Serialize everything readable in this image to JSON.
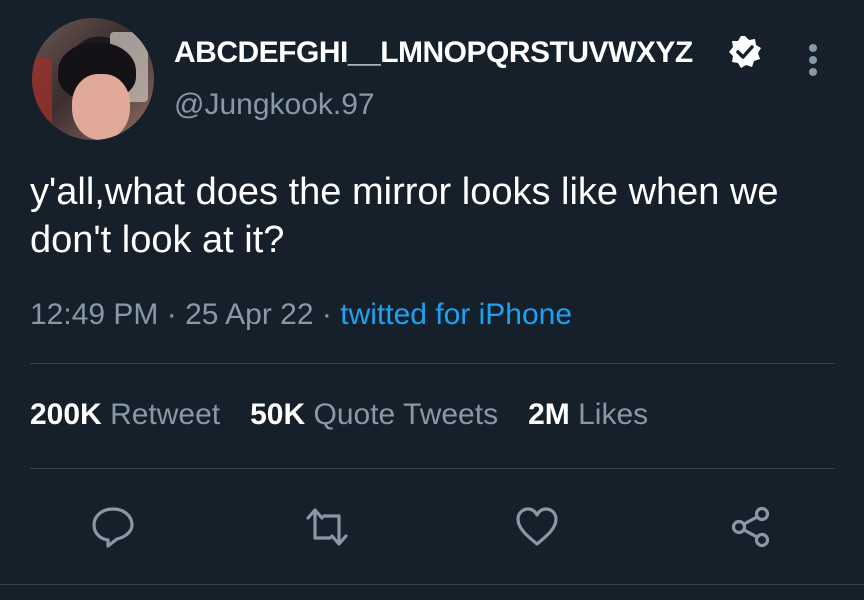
{
  "author": {
    "display_name": "ABCDEFGHI__LMNOPQRSTUVWXYZ",
    "handle": "@Jungkook.97",
    "verified": true
  },
  "tweet": {
    "text": "y'all,what does the mirror looks like when we don't look at it?",
    "time": "12:49 PM",
    "separator": "·",
    "date": "25 Apr 22",
    "source": "twitted for iPhone"
  },
  "stats": {
    "retweets_count": "200K",
    "retweets_label": "Retweet",
    "quotes_count": "50K",
    "quotes_label": "Quote Tweets",
    "likes_count": "2M",
    "likes_label": "Likes"
  },
  "icons": {
    "more": "more-vertical-icon",
    "verified": "verified-badge-icon",
    "reply": "reply-icon",
    "retweet": "retweet-icon",
    "like": "heart-icon",
    "share": "share-icon"
  },
  "colors": {
    "background": "#15202b",
    "secondary_text": "#8899a6",
    "link": "#1da1f2",
    "divider": "#38444d"
  }
}
